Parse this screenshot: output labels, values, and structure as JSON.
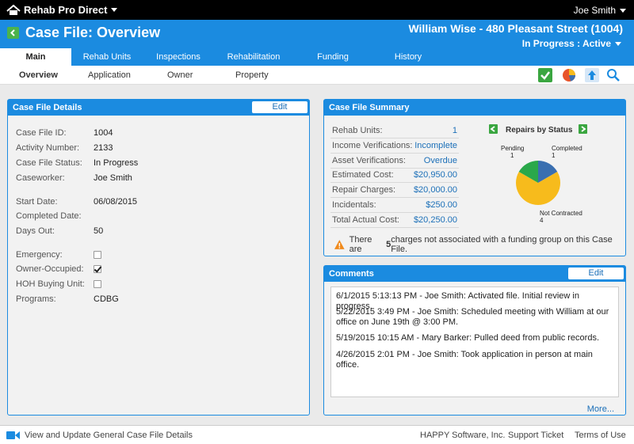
{
  "app": {
    "name": "Rehab Pro Direct",
    "user": "Joe Smith"
  },
  "header": {
    "title": "Case File: Overview",
    "record": "William Wise - 480 Pleasant Street  (1004)",
    "status": "In Progress : Active"
  },
  "tabs": [
    {
      "label": "Main"
    },
    {
      "label": "Rehab Units"
    },
    {
      "label": "Inspections"
    },
    {
      "label": "Rehabilitation"
    },
    {
      "label": "Funding"
    },
    {
      "label": "History"
    }
  ],
  "subnav": [
    {
      "label": "Overview"
    },
    {
      "label": "Application"
    },
    {
      "label": "Owner"
    },
    {
      "label": "Property"
    }
  ],
  "details": {
    "title": "Case File Details",
    "edit_label": "Edit",
    "fields": [
      {
        "label": "Case File ID:",
        "value": "1004"
      },
      {
        "label": "Activity Number:",
        "value": "2133"
      },
      {
        "label": "Case File Status:",
        "value": "In Progress"
      },
      {
        "label": "Caseworker:",
        "value": "Joe Smith"
      },
      {
        "label": "Start Date:",
        "value": "06/08/2015"
      },
      {
        "label": "Completed Date:",
        "value": ""
      },
      {
        "label": "Days Out:",
        "value": "50"
      },
      {
        "label": "Emergency:",
        "checked": false
      },
      {
        "label": "Owner-Occupied:",
        "checked": true
      },
      {
        "label": "HOH Buying Unit:",
        "checked": false
      },
      {
        "label": "Programs:",
        "value": "CDBG"
      }
    ]
  },
  "summary": {
    "title": "Case File Summary",
    "rows": [
      {
        "label": "Rehab Units:",
        "value": "1"
      },
      {
        "label": "Income Verifications:",
        "value": "Incomplete"
      },
      {
        "label": "Asset Verifications:",
        "value": "Overdue"
      },
      {
        "label": "Estimated Cost:",
        "value": "$20,950.00"
      },
      {
        "label": "Repair Charges:",
        "value": "$20,000.00"
      },
      {
        "label": "Incidentals:",
        "value": "$250.00"
      },
      {
        "label": "Total Actual Cost:",
        "value": "$20,250.00"
      }
    ],
    "warning_pre": "There are ",
    "warning_count": "5",
    "warning_post": " charges not associated with a funding group on this Case File.",
    "chart": {
      "title": "Repairs by Status",
      "slices": [
        {
          "label": "Pending",
          "count": "1",
          "value": 1,
          "color": "#2aa84a"
        },
        {
          "label": "Completed",
          "count": "1",
          "value": 1,
          "color": "#3a6fb0"
        },
        {
          "label": "Not Contracted",
          "count": "4",
          "value": 4,
          "color": "#f7bb1c"
        }
      ]
    }
  },
  "comments": {
    "title": "Comments",
    "edit_label": "Edit",
    "items": [
      "6/1/2015 5:13:13 PM - Joe Smith:  Activated file.  Initial review in progress.",
      "5/22/2015 3:49 PM - Joe Smith:  Scheduled meeting with William at our office on June 19th @ 3:00 PM.",
      "5/19/2015 10:15 AM - Mary Barker:  Pulled deed from public records.",
      "4/26/2015 2:01 PM - Joe Smith:  Took application in person at main office."
    ],
    "more_label": "More..."
  },
  "footer": {
    "help_text": "View and Update General Case File Details",
    "company": "HAPPY Software, Inc.",
    "support": "Support Ticket",
    "terms": "Terms of Use"
  }
}
